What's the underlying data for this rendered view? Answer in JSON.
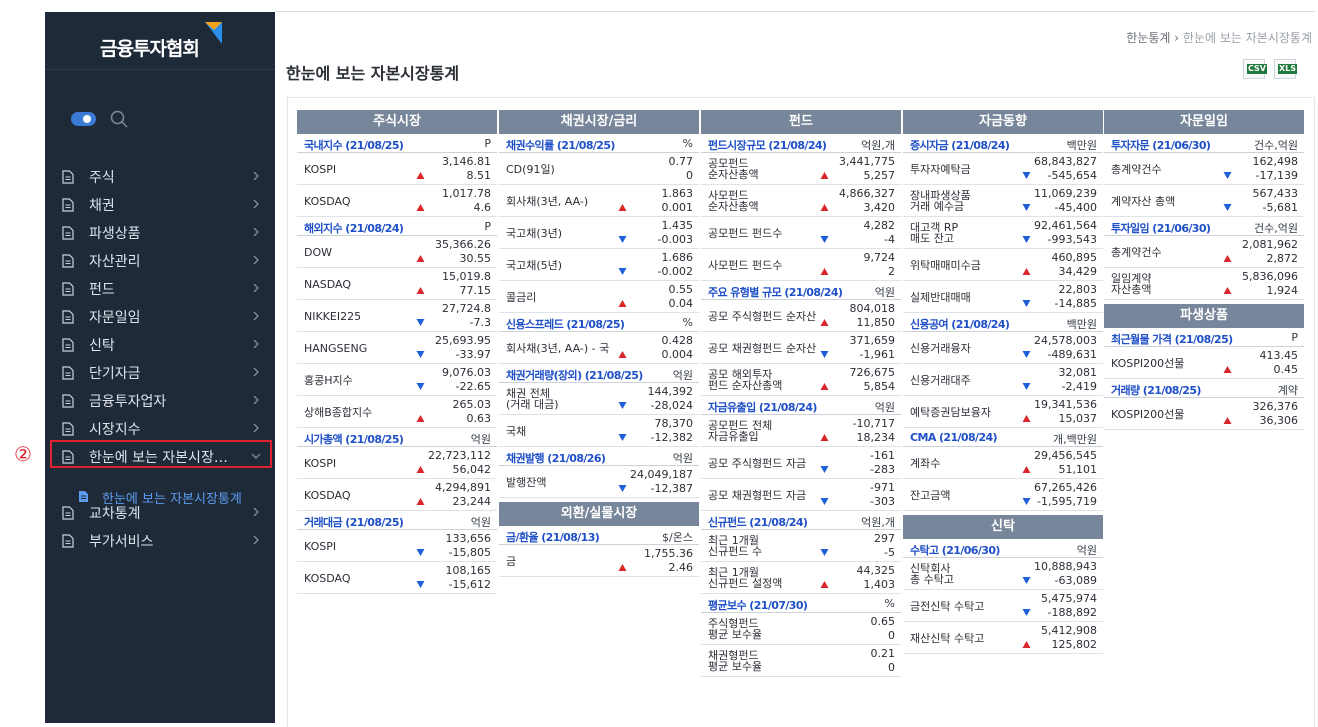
{
  "logo": {
    "text": "금융투자협회"
  },
  "sidebar": {
    "items": [
      {
        "label": "주식"
      },
      {
        "label": "채권"
      },
      {
        "label": "파생상품"
      },
      {
        "label": "자산관리"
      },
      {
        "label": "펀드"
      },
      {
        "label": "자문일임"
      },
      {
        "label": "신탁"
      },
      {
        "label": "단기자금"
      },
      {
        "label": "금융투자업자"
      },
      {
        "label": "시장지수"
      },
      {
        "label": "한눈에 보는 자본시장…"
      },
      {
        "label": "교차통계"
      },
      {
        "label": "부가서비스"
      }
    ],
    "sub_item": "한눈에 보는 자본시장통계",
    "annotation": "②"
  },
  "breadcrumb": {
    "home": "한눈통계",
    "sep": "›",
    "current": "한눈에 보는 자본시장통계"
  },
  "page_title": "한눈에 보는 자본시장통계",
  "downloads": {
    "csv": "CSV",
    "xls": "XLS"
  },
  "colors": {
    "up": "#d9262b",
    "down": "#1f5fd8",
    "header": "#77869a",
    "subhead": "#1f50c8",
    "sidebar": "#1f2a38"
  },
  "columns": [
    {
      "blocks": [
        {
          "header": "주식시장"
        },
        {
          "sub": "국내지수 (21/08/25)",
          "unit": "P"
        },
        {
          "row": {
            "name": [
              "KOSPI"
            ],
            "a": "3,146.81",
            "b": "8.51",
            "dir": "up",
            "h": 32
          }
        },
        {
          "row": {
            "name": [
              "KOSDAQ"
            ],
            "a": "1,017.78",
            "b": "4.6",
            "dir": "up",
            "h": 32
          }
        },
        {
          "sub": "해외지수 (21/08/24)",
          "unit": "P"
        },
        {
          "row": {
            "name": [
              "DOW"
            ],
            "a": "35,366.26",
            "b": "30.55",
            "dir": "up",
            "h": 32
          }
        },
        {
          "row": {
            "name": [
              "NASDAQ"
            ],
            "a": "15,019.8",
            "b": "77.15",
            "dir": "up",
            "h": 32
          }
        },
        {
          "row": {
            "name": [
              "NIKKEI225"
            ],
            "a": "27,724.8",
            "b": "-7.3",
            "dir": "down",
            "h": 32
          }
        },
        {
          "row": {
            "name": [
              "HANGSENG"
            ],
            "a": "25,693.95",
            "b": "-33.97",
            "dir": "down",
            "h": 32
          }
        },
        {
          "row": {
            "name": [
              "홍콩H지수"
            ],
            "a": "9,076.03",
            "b": "-22.65",
            "dir": "down",
            "h": 32
          }
        },
        {
          "row": {
            "name": [
              "상해B종합지수"
            ],
            "a": "265.03",
            "b": "0.63",
            "dir": "up",
            "h": 32
          }
        },
        {
          "sub": "시가총액 (21/08/25)",
          "unit": "억원"
        },
        {
          "row": {
            "name": [
              "KOSPI"
            ],
            "a": "22,723,112",
            "b": "56,042",
            "dir": "up",
            "h": 32
          }
        },
        {
          "row": {
            "name": [
              "KOSDAQ"
            ],
            "a": "4,294,891",
            "b": "23,244",
            "dir": "up",
            "h": 32
          }
        },
        {
          "sub": "거래대금 (21/08/25)",
          "unit": "억원"
        },
        {
          "row": {
            "name": [
              "KOSPI"
            ],
            "a": "133,656",
            "b": "-15,805",
            "dir": "down",
            "h": 32
          }
        },
        {
          "row": {
            "name": [
              "KOSDAQ"
            ],
            "a": "108,165",
            "b": "-15,612",
            "dir": "down",
            "h": 32
          }
        }
      ]
    },
    {
      "blocks": [
        {
          "header": "채권시장/금리"
        },
        {
          "sub": "채권수익률 (21/08/25)",
          "unit": "%"
        },
        {
          "row": {
            "name": [
              "CD(91일)"
            ],
            "a": "0.77",
            "b": "0",
            "dir": "",
            "h": 32
          }
        },
        {
          "row": {
            "name": [
              "회사채(3년, AA-)"
            ],
            "a": "1.863",
            "b": "0.001",
            "dir": "up",
            "h": 32
          }
        },
        {
          "row": {
            "name": [
              "국고채(3년)"
            ],
            "a": "1.435",
            "b": "-0.003",
            "dir": "down",
            "h": 32
          }
        },
        {
          "row": {
            "name": [
              "국고채(5년)"
            ],
            "a": "1.686",
            "b": "-0.002",
            "dir": "down",
            "h": 32
          }
        },
        {
          "row": {
            "name": [
              "콜금리"
            ],
            "a": "0.55",
            "b": "0.04",
            "dir": "up",
            "h": 32
          }
        },
        {
          "sub": "신용스프레드 (21/08/25)",
          "unit": "%"
        },
        {
          "row": {
            "name": [
              "회사채(3년, AA-) - 국"
            ],
            "a": "0.428",
            "b": "0.004",
            "dir": "up",
            "h": 32
          }
        },
        {
          "sub": "채권거래량(장외) (21/08/25)",
          "unit": "억원"
        },
        {
          "row": {
            "name": [
              "채권 전체",
              "(거래 대금)"
            ],
            "a": "144,392",
            "b": "-28,024",
            "dir": "down",
            "h": 32
          }
        },
        {
          "row": {
            "name": [
              "국채"
            ],
            "a": "78,370",
            "b": "-12,382",
            "dir": "down",
            "h": 32
          }
        },
        {
          "sub": "채권발행 (21/08/26)",
          "unit": "억원"
        },
        {
          "row": {
            "name": [
              "발행잔액"
            ],
            "a": "24,049,187",
            "b": "-12,387",
            "dir": "down",
            "h": 32
          }
        },
        {
          "header": "외환/실물시장"
        },
        {
          "sub": "금/환율 (21/08/13)",
          "unit": "$/온스"
        },
        {
          "row": {
            "name": [
              "금"
            ],
            "a": "1,755.36",
            "b": "2.46",
            "dir": "up",
            "h": 32
          }
        }
      ]
    },
    {
      "blocks": [
        {
          "header": "펀드"
        },
        {
          "sub": "펀드시장규모 (21/08/24)",
          "unit": "억원,개"
        },
        {
          "row": {
            "name": [
              "공모펀드",
              "순자산총액"
            ],
            "a": "3,441,775",
            "b": "5,257",
            "dir": "up",
            "h": 32
          }
        },
        {
          "row": {
            "name": [
              "사모펀드",
              "순자산총액"
            ],
            "a": "4,866,327",
            "b": "3,420",
            "dir": "up",
            "h": 32
          }
        },
        {
          "row": {
            "name": [
              "공모펀드 펀드수"
            ],
            "a": "4,282",
            "b": "-4",
            "dir": "down",
            "h": 32
          }
        },
        {
          "row": {
            "name": [
              "사모펀드 펀드수"
            ],
            "a": "9,724",
            "b": "2",
            "dir": "up",
            "h": 32
          }
        },
        {
          "sub": "주요 유형별 규모 (21/08/24)",
          "unit": "억원"
        },
        {
          "row": {
            "name": [
              "공모 주식형펀드 순자산"
            ],
            "a": "804,018",
            "b": "11,850",
            "dir": "up",
            "h": 32
          }
        },
        {
          "row": {
            "name": [
              "공모 채권형펀드 순자산"
            ],
            "a": "371,659",
            "b": "-1,961",
            "dir": "down",
            "h": 32
          }
        },
        {
          "row": {
            "name": [
              "공모 해외투자",
              "펀드 순자산총액"
            ],
            "a": "726,675",
            "b": "5,854",
            "dir": "up",
            "h": 32
          }
        },
        {
          "sub": "자금유출입 (21/08/24)",
          "unit": "억원"
        },
        {
          "row": {
            "name": [
              "공모펀드 전체",
              "자금유출입"
            ],
            "a": "-10,717",
            "b": "18,234",
            "dir": "up",
            "h": 32
          }
        },
        {
          "row": {
            "name": [
              "공모 주식형펀드 자금"
            ],
            "a": "-161",
            "b": "-283",
            "dir": "down",
            "h": 32
          }
        },
        {
          "row": {
            "name": [
              "공모 채권형펀드 자금"
            ],
            "a": "-971",
            "b": "-303",
            "dir": "down",
            "h": 32
          }
        },
        {
          "sub": "신규펀드 (21/08/24)",
          "unit": "억원,개"
        },
        {
          "row": {
            "name": [
              "최근 1개월",
              "신규펀드 수"
            ],
            "a": "297",
            "b": "-5",
            "dir": "down",
            "h": 32
          }
        },
        {
          "row": {
            "name": [
              "최근 1개월",
              "신규펀드 설정액"
            ],
            "a": "44,325",
            "b": "1,403",
            "dir": "up",
            "h": 32
          }
        },
        {
          "sub": "평균보수 (21/07/30)",
          "unit": "%"
        },
        {
          "row": {
            "name": [
              "주식형펀드",
              "평균 보수율"
            ],
            "a": "0.65",
            "b": "0",
            "dir": "",
            "h": 32
          }
        },
        {
          "row": {
            "name": [
              "채권형펀드",
              "평균 보수율"
            ],
            "a": "0.21",
            "b": "0",
            "dir": "",
            "h": 32
          }
        }
      ]
    },
    {
      "blocks": [
        {
          "header": "자금동향"
        },
        {
          "sub": "증시자금 (21/08/24)",
          "unit": "백만원"
        },
        {
          "row": {
            "name": [
              "투자자예탁금"
            ],
            "a": "68,843,827",
            "b": "-545,654",
            "dir": "down",
            "h": 32
          }
        },
        {
          "row": {
            "name": [
              "장내파생상품",
              "거래 예수금"
            ],
            "a": "11,069,239",
            "b": "-45,400",
            "dir": "down",
            "h": 32
          }
        },
        {
          "row": {
            "name": [
              "대고객 RP",
              "매도 잔고"
            ],
            "a": "92,461,564",
            "b": "-993,543",
            "dir": "down",
            "h": 32
          }
        },
        {
          "row": {
            "name": [
              "위탁매매미수금"
            ],
            "a": "460,895",
            "b": "34,429",
            "dir": "up",
            "h": 32
          }
        },
        {
          "row": {
            "name": [
              "실제반대매매"
            ],
            "a": "22,803",
            "b": "-14,885",
            "dir": "down",
            "h": 32
          }
        },
        {
          "sub": "신용공여 (21/08/24)",
          "unit": "백만원"
        },
        {
          "row": {
            "name": [
              "신용거래융자"
            ],
            "a": "24,578,003",
            "b": "-489,631",
            "dir": "down",
            "h": 32
          }
        },
        {
          "row": {
            "name": [
              "신용거래대주"
            ],
            "a": "32,081",
            "b": "-2,419",
            "dir": "down",
            "h": 32
          }
        },
        {
          "row": {
            "name": [
              "예탁증권담보융자"
            ],
            "a": "19,341,536",
            "b": "15,037",
            "dir": "up",
            "h": 32
          }
        },
        {
          "sub": "CMA (21/08/24)",
          "unit": "개,백만원"
        },
        {
          "row": {
            "name": [
              "계좌수"
            ],
            "a": "29,456,545",
            "b": "51,101",
            "dir": "up",
            "h": 32
          }
        },
        {
          "row": {
            "name": [
              "잔고금액"
            ],
            "a": "67,265,426",
            "b": "-1,595,719",
            "dir": "down",
            "h": 32
          }
        },
        {
          "header": "신탁"
        },
        {
          "sub": "수탁고 (21/06/30)",
          "unit": "억원"
        },
        {
          "row": {
            "name": [
              "신탁회사",
              "총 수탁고"
            ],
            "a": "10,888,943",
            "b": "-63,089",
            "dir": "down",
            "h": 32
          }
        },
        {
          "row": {
            "name": [
              "금전신탁 수탁고"
            ],
            "a": "5,475,974",
            "b": "-188,892",
            "dir": "down",
            "h": 32
          }
        },
        {
          "row": {
            "name": [
              "재산신탁 수탁고"
            ],
            "a": "5,412,908",
            "b": "125,802",
            "dir": "up",
            "h": 32
          }
        }
      ]
    },
    {
      "blocks": [
        {
          "header": "자문일임"
        },
        {
          "sub": "투자자문 (21/06/30)",
          "unit": "건수,억원"
        },
        {
          "row": {
            "name": [
              "총계약건수"
            ],
            "a": "162,498",
            "b": "-17,139",
            "dir": "down",
            "h": 32
          }
        },
        {
          "row": {
            "name": [
              "계약자산 총액"
            ],
            "a": "567,433",
            "b": "-5,681",
            "dir": "down",
            "h": 32
          }
        },
        {
          "sub": "투자일임 (21/06/30)",
          "unit": "건수,억원"
        },
        {
          "row": {
            "name": [
              "총계약건수"
            ],
            "a": "2,081,962",
            "b": "2,872",
            "dir": "up",
            "h": 32
          }
        },
        {
          "row": {
            "name": [
              "일임계약",
              "자산총액"
            ],
            "a": "5,836,096",
            "b": "1,924",
            "dir": "up",
            "h": 32
          }
        },
        {
          "header": "파생상품"
        },
        {
          "sub": "최근월물 가격 (21/08/25)",
          "unit": "P"
        },
        {
          "row": {
            "name": [
              "KOSPI200선물"
            ],
            "a": "413.45",
            "b": "0.45",
            "dir": "up",
            "h": 32
          }
        },
        {
          "sub": "거래량 (21/08/25)",
          "unit": "계약"
        },
        {
          "row": {
            "name": [
              "KOSPI200선물"
            ],
            "a": "326,376",
            "b": "36,306",
            "dir": "up",
            "h": 32
          }
        }
      ]
    }
  ]
}
